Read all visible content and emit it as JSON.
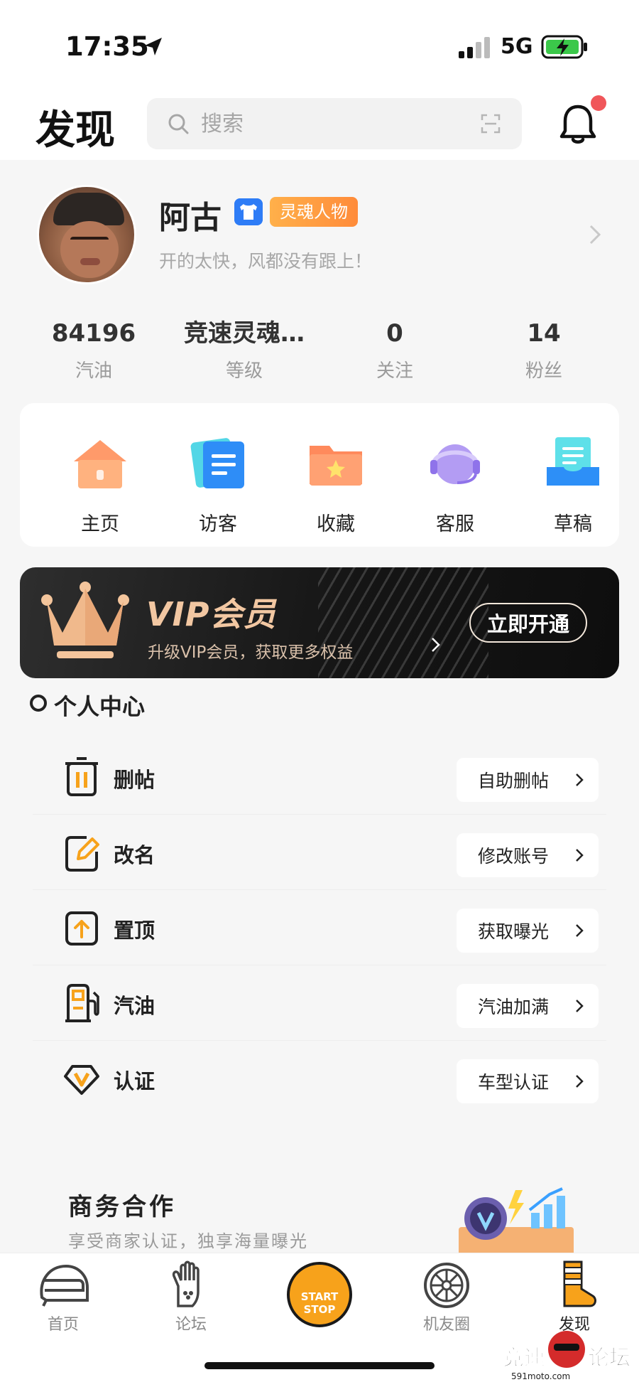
{
  "status_bar": {
    "time": "17:35",
    "network": "5G"
  },
  "header": {
    "title": "发现",
    "search_placeholder": "搜索"
  },
  "profile": {
    "name": "阿古",
    "title_badge": "灵魂人物",
    "bio": "开的太快，风都没有跟上！"
  },
  "stats": [
    {
      "value": "84196",
      "label": "汽油"
    },
    {
      "value": "竞速灵魂…",
      "label": "等级"
    },
    {
      "value": "0",
      "label": "关注"
    },
    {
      "value": "14",
      "label": "粉丝"
    }
  ],
  "quick_actions": [
    {
      "label": "主页",
      "icon": "house-icon"
    },
    {
      "label": "访客",
      "icon": "visitor-cards-icon"
    },
    {
      "label": "收藏",
      "icon": "star-folder-icon"
    },
    {
      "label": "客服",
      "icon": "headset-icon"
    },
    {
      "label": "草稿",
      "icon": "draft-tray-icon"
    }
  ],
  "vip": {
    "title": "VIP会员",
    "subtitle": "升级VIP会员，获取更多权益",
    "button": "立即开通"
  },
  "personal_center": {
    "title": "个人中心",
    "items": [
      {
        "label": "删帖",
        "action": "自助删帖",
        "icon": "trash-icon"
      },
      {
        "label": "改名",
        "action": "修改账号",
        "icon": "edit-icon"
      },
      {
        "label": "置顶",
        "action": "获取曝光",
        "icon": "pin-top-icon"
      },
      {
        "label": "汽油",
        "action": "汽油加满",
        "icon": "fuel-pump-icon"
      },
      {
        "label": "认证",
        "action": "车型认证",
        "icon": "verified-v-icon"
      }
    ]
  },
  "business": {
    "title": "商务合作",
    "subtitle": "享受商家认证，独享海量曝光"
  },
  "tab_bar": {
    "items": [
      {
        "label": "首页",
        "icon": "helmet-icon"
      },
      {
        "label": "论坛",
        "icon": "glove-icon"
      },
      {
        "label": "START STOP",
        "icon": "start-stop-icon"
      },
      {
        "label": "机友圈",
        "icon": "wheel-icon"
      },
      {
        "label": "发现",
        "icon": "boot-icon"
      }
    ],
    "start_top": "START",
    "start_bottom": "STOP"
  },
  "watermark": {
    "text": "竞速论坛",
    "url": "591moto.com"
  },
  "colors": {
    "accent": "#f7a21b",
    "badge_orange": "#ff8b3a",
    "vip_gold": "#f2c7a2",
    "notify_red": "#f0565a"
  }
}
